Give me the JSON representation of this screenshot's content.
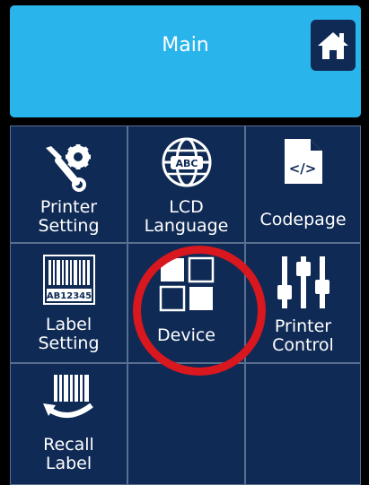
{
  "header": {
    "title": "Main"
  },
  "tiles": [
    {
      "label": "Printer\nSetting"
    },
    {
      "label": "LCD\nLanguage",
      "icon_text": "ABC"
    },
    {
      "label": "Codepage",
      "icon_text": "</>"
    },
    {
      "label": "Label\nSetting",
      "icon_text": "AB12345"
    },
    {
      "label": "Device"
    },
    {
      "label": "Printer\nControl"
    },
    {
      "label": "Recall\nLabel"
    }
  ],
  "colors": {
    "header_bg": "#2ab4ec",
    "tile_bg": "#0f2a55",
    "highlight": "#d8171f"
  },
  "icons": [
    "home-icon",
    "wrench-gear-icon",
    "globe-icon",
    "document-code-icon",
    "barcode-icon",
    "grid-squares-icon",
    "sliders-icon",
    "recall-barcode-icon"
  ]
}
